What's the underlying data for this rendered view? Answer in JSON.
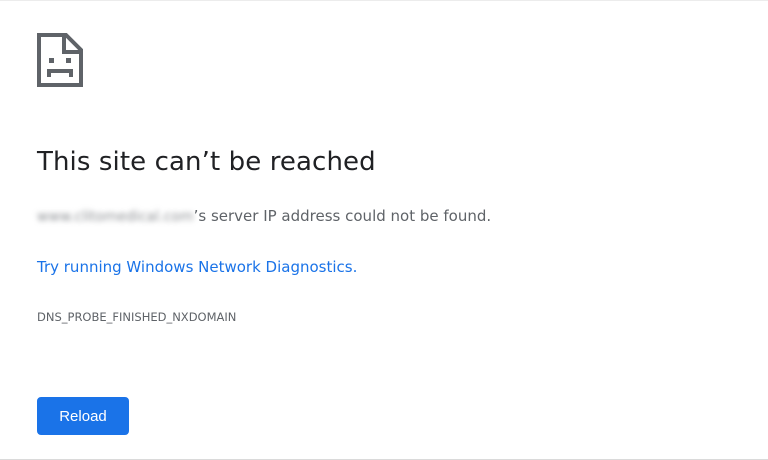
{
  "error_page": {
    "icon": "sad-page-icon",
    "title": "This site can’t be reached",
    "summary": {
      "host_blurred": "www.clitomedical.com",
      "message": "’s server IP address could not be found."
    },
    "diagnostics_link": "Try running Windows Network Diagnostics",
    "diagnostics_suffix": ".",
    "error_code": "DNS_PROBE_FINISHED_NXDOMAIN",
    "reload_label": "Reload"
  },
  "colors": {
    "title": "#202124",
    "body_text": "#5f6368",
    "link": "#1a73e8",
    "button_bg": "#1a73e8",
    "button_text": "#ffffff"
  }
}
